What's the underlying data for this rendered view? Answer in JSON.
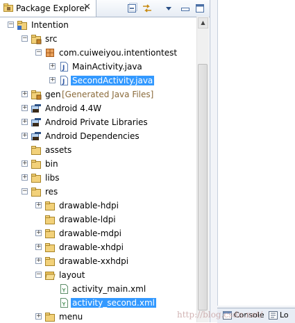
{
  "view": {
    "tab_title": "Package Explorer",
    "close_glyph": "✕"
  },
  "toolbar": {
    "icons": [
      "collapse-all-icon",
      "link-with-editor-icon",
      "view-menu-icon",
      "minimize-icon",
      "maximize-icon"
    ]
  },
  "tree": [
    {
      "label": "Intention",
      "icon": "project-icon",
      "toggle": "-",
      "depth": 0
    },
    {
      "label": "src",
      "icon": "source-folder-icon",
      "toggle": "-",
      "depth": 1
    },
    {
      "label": "com.cuiweiyou.intentiontest",
      "icon": "package-icon",
      "toggle": "-",
      "depth": 2
    },
    {
      "label": "MainActivity.java",
      "icon": "java-file-icon",
      "toggle": "+",
      "depth": 3
    },
    {
      "label": "SecondActivity.java",
      "icon": "java-file-icon",
      "toggle": "+",
      "depth": 3,
      "selected": true
    },
    {
      "label": "gen",
      "suffix": "[Generated Java Files]",
      "icon": "source-folder-icon",
      "toggle": "+",
      "depth": 1
    },
    {
      "label": "Android 4.4W",
      "icon": "library-icon",
      "toggle": "+",
      "depth": 1
    },
    {
      "label": "Android Private Libraries",
      "icon": "library-icon",
      "toggle": "+",
      "depth": 1
    },
    {
      "label": "Android Dependencies",
      "icon": "library-icon",
      "toggle": "+",
      "depth": 1
    },
    {
      "label": "assets",
      "icon": "folder-icon",
      "toggle": "",
      "depth": 1
    },
    {
      "label": "bin",
      "icon": "folder-icon",
      "toggle": "+",
      "depth": 1
    },
    {
      "label": "libs",
      "icon": "folder-icon",
      "toggle": "+",
      "depth": 1
    },
    {
      "label": "res",
      "icon": "folder-icon",
      "toggle": "-",
      "depth": 1
    },
    {
      "label": "drawable-hdpi",
      "icon": "folder-icon",
      "toggle": "+",
      "depth": 2
    },
    {
      "label": "drawable-ldpi",
      "icon": "folder-icon",
      "toggle": "",
      "depth": 2
    },
    {
      "label": "drawable-mdpi",
      "icon": "folder-icon",
      "toggle": "+",
      "depth": 2
    },
    {
      "label": "drawable-xhdpi",
      "icon": "folder-icon",
      "toggle": "+",
      "depth": 2
    },
    {
      "label": "drawable-xxhdpi",
      "icon": "folder-icon",
      "toggle": "+",
      "depth": 2
    },
    {
      "label": "layout",
      "icon": "folder-open-icon",
      "toggle": "-",
      "depth": 2
    },
    {
      "label": "activity_main.xml",
      "icon": "xml-file-icon",
      "toggle": "",
      "depth": 3
    },
    {
      "label": "activity_second.xml",
      "icon": "xml-file-icon",
      "toggle": "",
      "depth": 3,
      "selected": true
    },
    {
      "label": "menu",
      "icon": "folder-icon",
      "toggle": "+",
      "depth": 2
    }
  ],
  "bottom_tabs": [
    "Console",
    "Lo"
  ],
  "watermark": "http://blog.csdn.net/"
}
